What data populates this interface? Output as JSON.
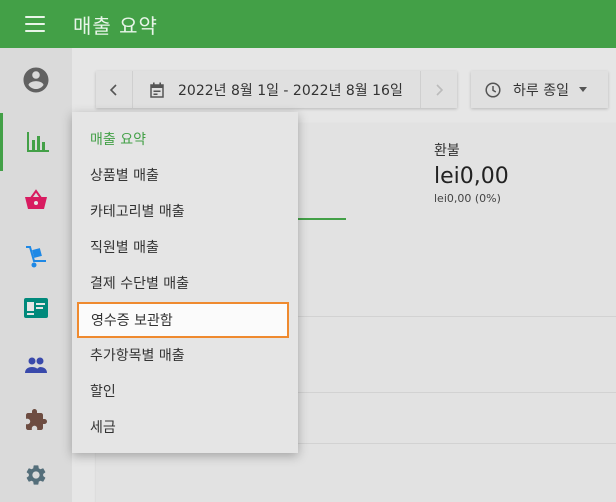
{
  "header": {
    "menu_icon": "menu-icon",
    "title": "매출 요약",
    "accent_color": "#43a047"
  },
  "sidebar": {
    "items": [
      {
        "icon": "account-circle-icon",
        "color": "#616161"
      },
      {
        "icon": "bar-chart-icon",
        "color": "#43a047",
        "active": true
      },
      {
        "icon": "basket-icon",
        "color": "#d81b60"
      },
      {
        "icon": "hand-truck-icon",
        "color": "#1e88e5"
      },
      {
        "icon": "id-card-icon",
        "color": "#00897b"
      },
      {
        "icon": "people-icon",
        "color": "#3949ab"
      },
      {
        "icon": "puzzle-icon",
        "color": "#6d4c41"
      },
      {
        "icon": "gear-icon",
        "color": "#546e7a"
      }
    ]
  },
  "toolbar": {
    "date_range": "2022년 8월 1일 - 2022년 8월 16일",
    "day_select": "하루 종일"
  },
  "summary": {
    "refund_label": "환불",
    "refund_value": "lei0,00",
    "refund_sub": "lei0,00 (0%)"
  },
  "dropdown": {
    "items": [
      {
        "label": "매출 요약",
        "selected": true
      },
      {
        "label": "상품별 매출"
      },
      {
        "label": "카테고리별 매출"
      },
      {
        "label": "직원별 매출"
      },
      {
        "label": "결제 수단별 매출"
      },
      {
        "label": "영수증 보관함",
        "highlighted": true
      },
      {
        "label": "추가항목별 매출"
      },
      {
        "label": "할인"
      },
      {
        "label": "세금"
      }
    ],
    "highlight_color": "#ef8a2f"
  }
}
